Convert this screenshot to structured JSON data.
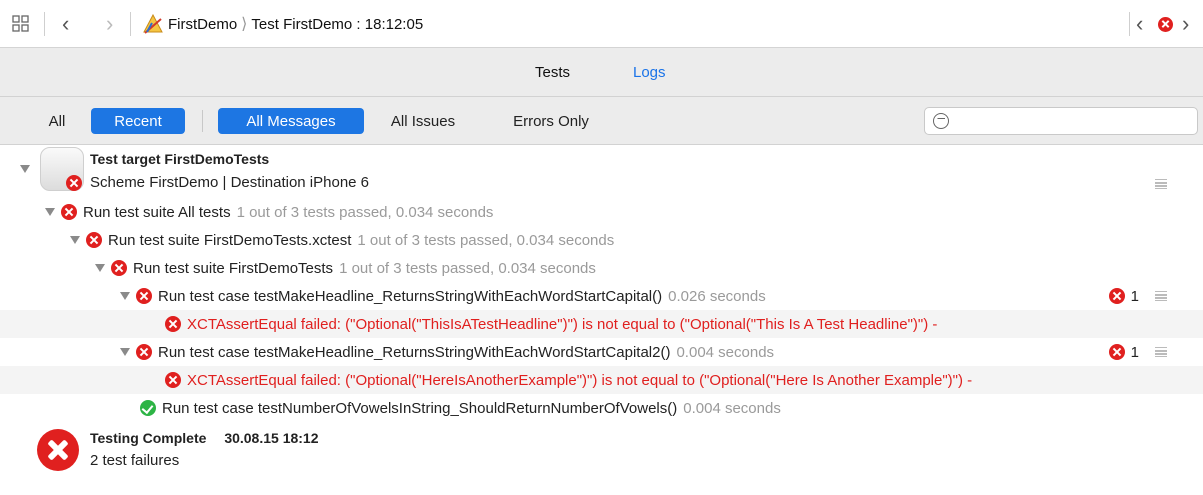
{
  "jumpbar": {
    "project": "FirstDemo",
    "run": "Test FirstDemo : 18:12:05"
  },
  "tabs": {
    "tests": "Tests",
    "logs": "Logs"
  },
  "filters": {
    "all": "All",
    "recent": "Recent",
    "all_messages": "All Messages",
    "all_issues": "All Issues",
    "errors_only": "Errors Only"
  },
  "log": {
    "target_title": "Test target FirstDemoTests",
    "target_subtitle": "Scheme FirstDemo | Destination iPhone 6",
    "rows": [
      {
        "label": "Run test suite All tests",
        "detail": "1 out of 3 tests passed, 0.034 seconds"
      },
      {
        "label": "Run test suite FirstDemoTests.xctest",
        "detail": "1 out of 3 tests passed, 0.034 seconds"
      },
      {
        "label": "Run test suite FirstDemoTests",
        "detail": "1 out of 3 tests passed, 0.034 seconds"
      },
      {
        "label": "Run test case testMakeHeadline_ReturnsStringWithEachWordStartCapital()",
        "detail": "0.026 seconds",
        "count": "1"
      },
      {
        "label": "XCTAssertEqual failed: (\"Optional(\"ThisIsATestHeadline\")\") is not equal to (\"Optional(\"This Is A Test Headline\")\") -"
      },
      {
        "label": "Run test case testMakeHeadline_ReturnsStringWithEachWordStartCapital2()",
        "detail": "0.004 seconds",
        "count": "1"
      },
      {
        "label": "XCTAssertEqual failed: (\"Optional(\"HereIsAnotherExample\")\") is not equal to (\"Optional(\"Here Is Another Example\")\") -"
      },
      {
        "label": "Run test case testNumberOfVowelsInString_ShouldReturnNumberOfVowels()",
        "detail": "0.004 seconds"
      }
    ],
    "complete_title": "Testing Complete",
    "complete_time": "30.08.15 18:12",
    "complete_detail": "2 test failures"
  }
}
